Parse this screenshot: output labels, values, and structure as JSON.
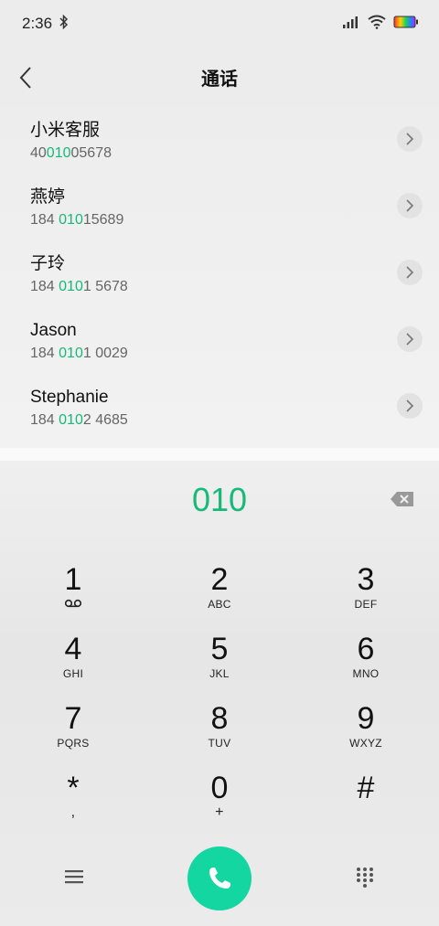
{
  "status_bar": {
    "time": "2:36",
    "icons": [
      "bluetooth-icon",
      "signal-icon",
      "wifi-icon",
      "battery-icon"
    ]
  },
  "header": {
    "back_icon": "chevron-left-icon",
    "title": "通话"
  },
  "contacts": [
    {
      "name": "小米客服",
      "number_pre": "40",
      "number_match": "010",
      "number_post": "05678"
    },
    {
      "name": "燕婷",
      "number_pre": "184 ",
      "number_match": "010",
      "number_post": "15689"
    },
    {
      "name": "子玲",
      "number_pre": "184 ",
      "number_match": "010",
      "number_post": "1 5678"
    },
    {
      "name": "Jason",
      "number_pre": "184 ",
      "number_match": "010",
      "number_post": "1 0029"
    },
    {
      "name": "Stephanie",
      "number_pre": "184 ",
      "number_match": "010",
      "number_post": "2 4685"
    }
  ],
  "dialpad": {
    "entered": "010",
    "accent_color": "#17b978",
    "call_color": "#14d6a1",
    "keys": [
      {
        "digit": "1",
        "sub": ""
      },
      {
        "digit": "2",
        "sub": "ABC"
      },
      {
        "digit": "3",
        "sub": "DEF"
      },
      {
        "digit": "4",
        "sub": "GHI"
      },
      {
        "digit": "5",
        "sub": "JKL"
      },
      {
        "digit": "6",
        "sub": "MNO"
      },
      {
        "digit": "7",
        "sub": "PQRS"
      },
      {
        "digit": "8",
        "sub": "TUV"
      },
      {
        "digit": "9",
        "sub": "WXYZ"
      },
      {
        "digit": "*",
        "sub": ","
      },
      {
        "digit": "0",
        "sub": "+"
      },
      {
        "digit": "#",
        "sub": ""
      }
    ]
  }
}
